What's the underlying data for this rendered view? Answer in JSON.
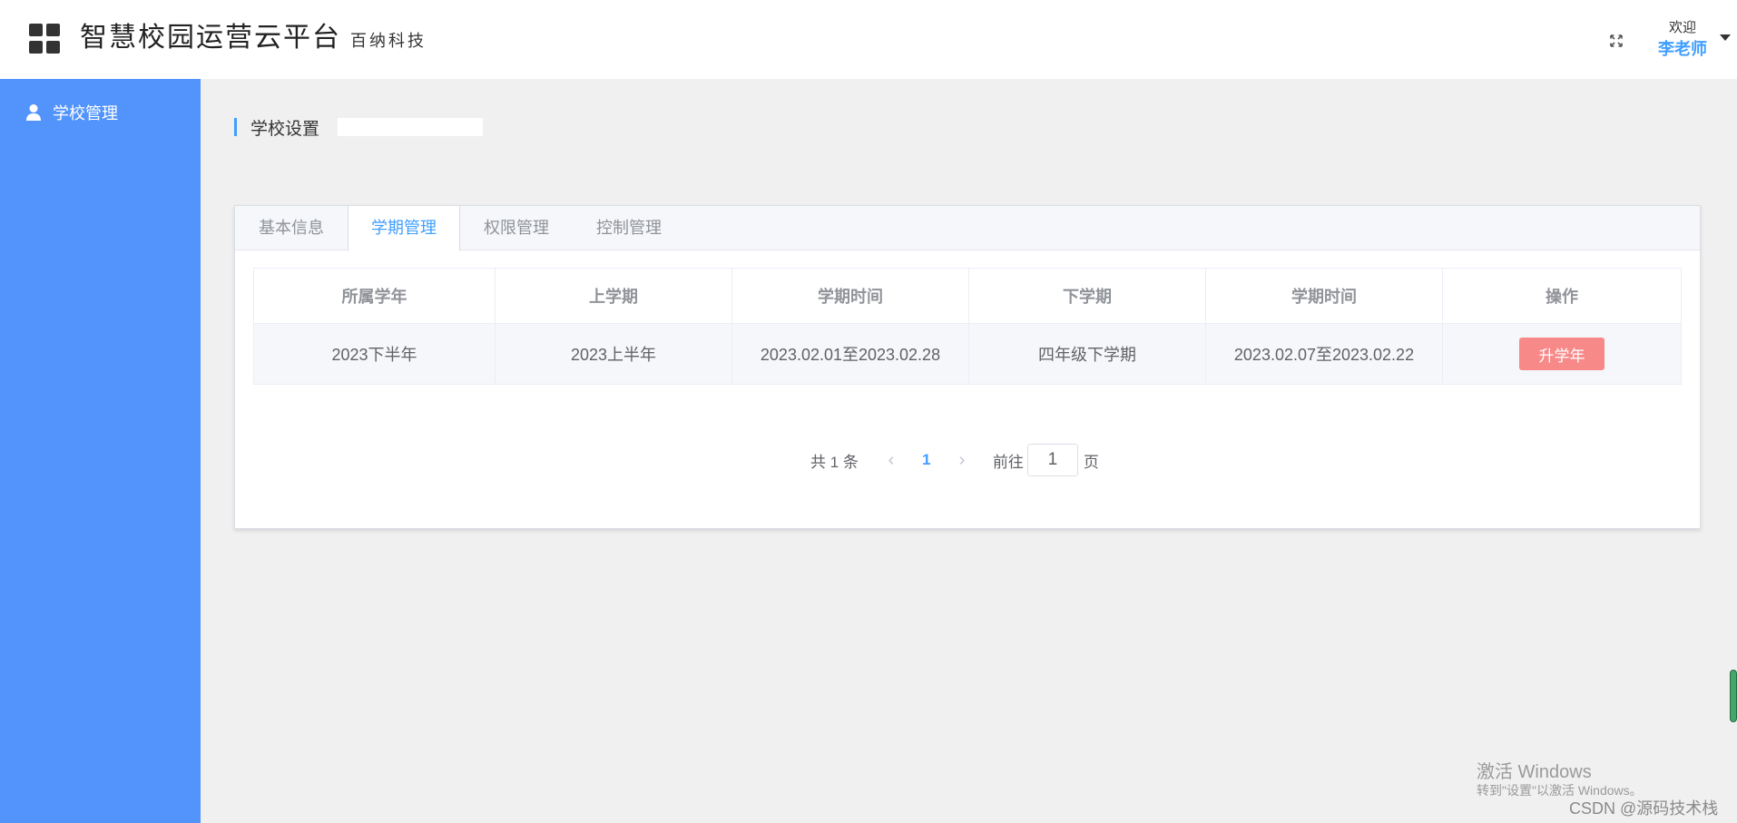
{
  "header": {
    "title": "智慧校园运营云平台",
    "subtitle": "百纳科技",
    "welcome": "欢迎",
    "user_name": "李老师"
  },
  "sidebar": {
    "items": [
      {
        "label": "学校管理",
        "icon": "user-icon"
      }
    ]
  },
  "breadcrumb": {
    "title": "学校设置"
  },
  "tabs": [
    {
      "label": "基本信息"
    },
    {
      "label": "学期管理",
      "active": true
    },
    {
      "label": "权限管理"
    },
    {
      "label": "控制管理"
    }
  ],
  "table": {
    "headers": [
      "所属学年",
      "上学期",
      "学期时间",
      "下学期",
      "学期时间",
      "操作"
    ],
    "rows": [
      {
        "year": "2023下半年",
        "first_term": "2023上半年",
        "first_term_time": "2023.02.01至2023.02.28",
        "second_term": "四年级下学期",
        "second_term_time": "2023.02.07至2023.02.22",
        "action_label": "升学年"
      }
    ]
  },
  "pagination": {
    "total_text": "共 1 条",
    "current_page": "1",
    "goto_label": "前往",
    "goto_value": "1",
    "page_suffix": "页"
  },
  "watermark": {
    "line1": "激活 Windows",
    "line2": "转到\"设置\"以激活 Windows。",
    "credit": "CSDN @源码技术栈"
  },
  "colors": {
    "sidebar_bg": "#5294fb",
    "accent": "#409eff",
    "danger_button": "#f78989"
  }
}
